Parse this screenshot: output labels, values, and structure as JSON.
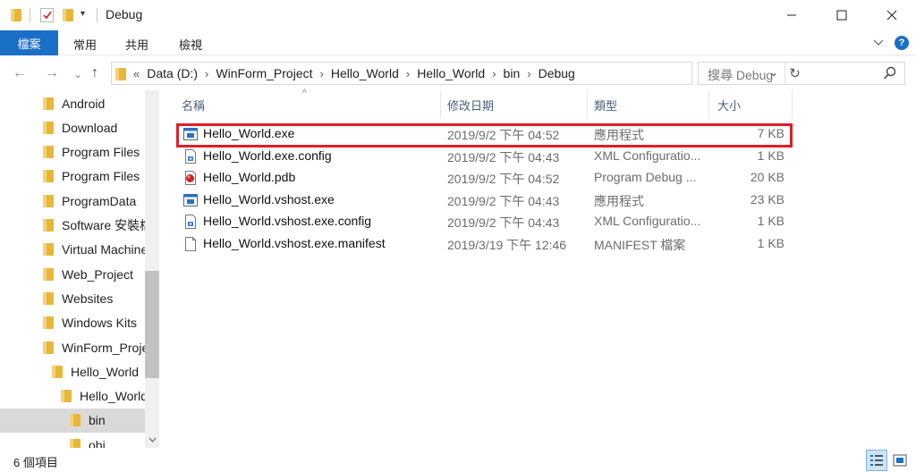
{
  "window": {
    "title": "Debug",
    "qa_dropdown": "▾",
    "controls": {
      "minimize": "—",
      "maximize": "☐",
      "close": "✕"
    }
  },
  "ribbon": {
    "file_tab": "檔案",
    "tabs": [
      "常用",
      "共用",
      "檢視"
    ],
    "collapse": "⌄",
    "help": "?"
  },
  "nav": {
    "back": "←",
    "forward": "→",
    "recent": "⌄",
    "up": "↑"
  },
  "address": {
    "overflow": "«",
    "crumbs": [
      "Data (D:)",
      "WinForm_Project",
      "Hello_World",
      "Hello_World",
      "bin",
      "Debug"
    ],
    "separator": "›",
    "dropdown": "⌄",
    "refresh": "↻"
  },
  "search": {
    "placeholder": "搜尋 Debug"
  },
  "tree": [
    {
      "label": "Android",
      "indent": 0,
      "selected": false
    },
    {
      "label": "Download",
      "indent": 0,
      "selected": false
    },
    {
      "label": "Program Files",
      "indent": 0,
      "selected": false
    },
    {
      "label": "Program Files",
      "indent": 0,
      "selected": false
    },
    {
      "label": "ProgramData",
      "indent": 0,
      "selected": false
    },
    {
      "label": "Software 安裝檔",
      "indent": 0,
      "selected": false
    },
    {
      "label": "Virtual Machines",
      "indent": 0,
      "selected": false
    },
    {
      "label": "Web_Project",
      "indent": 0,
      "selected": false
    },
    {
      "label": "Websites",
      "indent": 0,
      "selected": false
    },
    {
      "label": "Windows Kits",
      "indent": 0,
      "selected": false
    },
    {
      "label": "WinForm_Project",
      "indent": 0,
      "selected": false
    },
    {
      "label": "Hello_World",
      "indent": 1,
      "selected": false
    },
    {
      "label": "Hello_World",
      "indent": 2,
      "selected": false
    },
    {
      "label": "bin",
      "indent": 3,
      "selected": true
    },
    {
      "label": "obj",
      "indent": 3,
      "selected": false
    }
  ],
  "columns": {
    "name": "名稱",
    "date": "修改日期",
    "type": "類型",
    "size": "大小",
    "sort_indicator": "^"
  },
  "files": [
    {
      "name": "Hello_World.exe",
      "date": "2019/9/2 下午 04:52",
      "type": "應用程式",
      "size": "7 KB",
      "icon": "exe"
    },
    {
      "name": "Hello_World.exe.config",
      "date": "2019/9/2 下午 04:43",
      "type": "XML Configuratio...",
      "size": "1 KB",
      "icon": "config"
    },
    {
      "name": "Hello_World.pdb",
      "date": "2019/9/2 下午 04:52",
      "type": "Program Debug ...",
      "size": "20 KB",
      "icon": "pdb"
    },
    {
      "name": "Hello_World.vshost.exe",
      "date": "2019/9/2 下午 04:43",
      "type": "應用程式",
      "size": "23 KB",
      "icon": "exe"
    },
    {
      "name": "Hello_World.vshost.exe.config",
      "date": "2019/9/2 下午 04:43",
      "type": "XML Configuratio...",
      "size": "1 KB",
      "icon": "config"
    },
    {
      "name": "Hello_World.vshost.exe.manifest",
      "date": "2019/3/19 下午 12:46",
      "type": "MANIFEST 檔案",
      "size": "1 KB",
      "icon": "file"
    }
  ],
  "status": {
    "item_count": "6 個項目"
  },
  "colors": {
    "accent": "#1a6fc7",
    "highlight": "#e01e25",
    "folder": "#e8b73a"
  }
}
